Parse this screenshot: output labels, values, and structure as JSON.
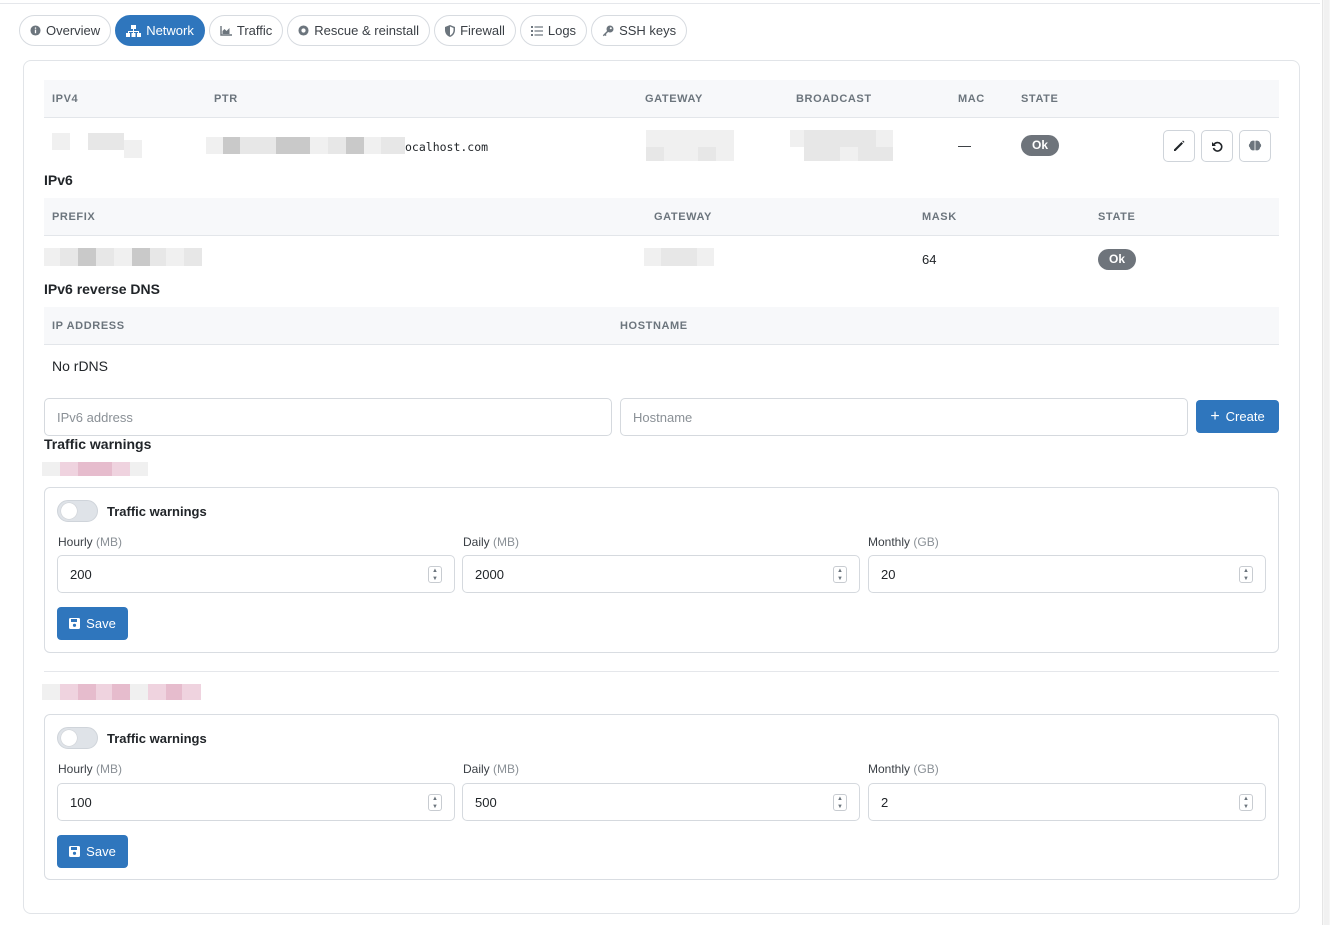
{
  "tabs": [
    {
      "label": "Overview",
      "icon": "info-circle-icon",
      "active": false
    },
    {
      "label": "Network",
      "icon": "network-icon",
      "active": true
    },
    {
      "label": "Traffic",
      "icon": "chart-area-icon",
      "active": false
    },
    {
      "label": "Rescue & reinstall",
      "icon": "life-ring-icon",
      "active": false
    },
    {
      "label": "Firewall",
      "icon": "shield-icon",
      "active": false
    },
    {
      "label": "Logs",
      "icon": "list-icon",
      "active": false
    },
    {
      "label": "SSH keys",
      "icon": "key-icon",
      "active": false
    }
  ],
  "ipv4": {
    "headers": [
      "IPv4",
      "PTR",
      "Gateway",
      "Broadcast",
      "MAC",
      "State"
    ],
    "row": {
      "ptr_suffix": "ocalhost.com",
      "mac": "—",
      "state": "Ok"
    },
    "actions": [
      {
        "icon": "pencil-icon"
      },
      {
        "icon": "undo-icon"
      },
      {
        "icon": "brain-icon"
      }
    ]
  },
  "ipv6": {
    "title": "IPv6",
    "headers": [
      "Prefix",
      "Gateway",
      "Mask",
      "State"
    ],
    "row": {
      "mask": "64",
      "state": "Ok"
    }
  },
  "rdns": {
    "title": "IPv6 reverse DNS",
    "headers": [
      "IP address",
      "Hostname"
    ],
    "empty_text": "No rDNS",
    "ip_placeholder": "IPv6 address",
    "hostname_placeholder": "Hostname",
    "create_label": "Create"
  },
  "traffic": {
    "title": "Traffic warnings",
    "groups": [
      {
        "toggle_label": "Traffic warnings",
        "enabled": false,
        "hourly_label": "Hourly",
        "hourly_unit": "(MB)",
        "hourly_value": "200",
        "daily_label": "Daily",
        "daily_unit": "(MB)",
        "daily_value": "2000",
        "monthly_label": "Monthly",
        "monthly_unit": "(GB)",
        "monthly_value": "20",
        "save_label": "Save"
      },
      {
        "toggle_label": "Traffic warnings",
        "enabled": false,
        "hourly_label": "Hourly",
        "hourly_unit": "(MB)",
        "hourly_value": "100",
        "daily_label": "Daily",
        "daily_unit": "(MB)",
        "daily_value": "500",
        "monthly_label": "Monthly",
        "monthly_unit": "(GB)",
        "monthly_value": "2",
        "save_label": "Save"
      }
    ]
  },
  "colors": {
    "primary": "#2f76bd",
    "badge": "#6e747b"
  }
}
